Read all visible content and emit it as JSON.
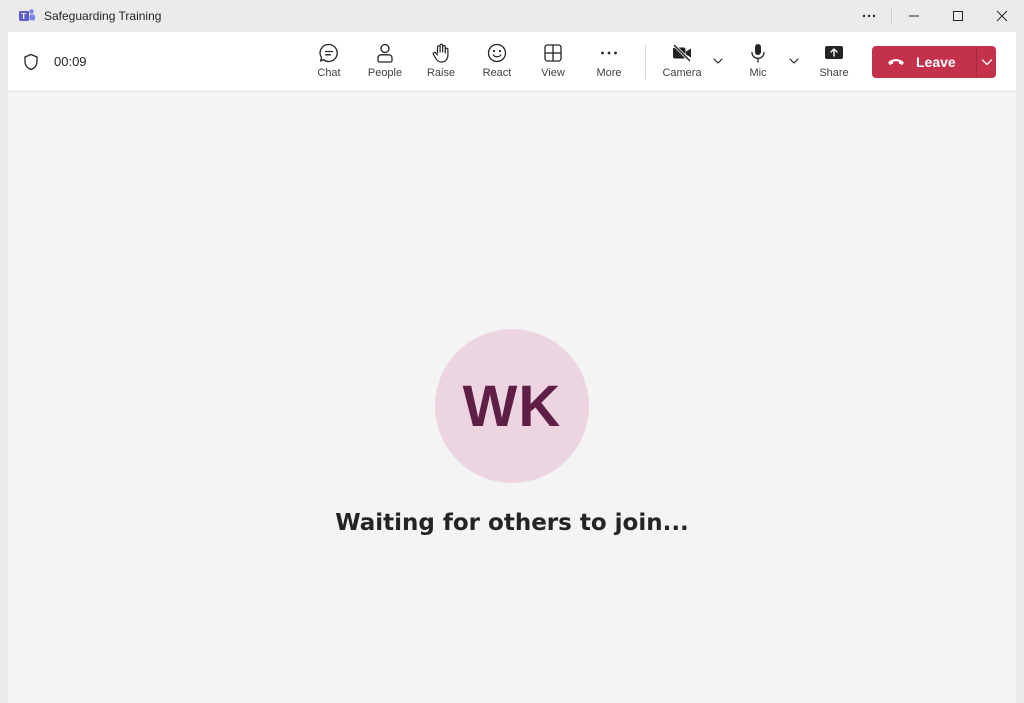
{
  "window": {
    "title": "Safeguarding Training",
    "icons": [
      "teams-logo-icon",
      "more-options-icon",
      "minimize-icon",
      "maximize-icon",
      "close-icon"
    ]
  },
  "meeting": {
    "timer": "00:09",
    "toolbar": {
      "chat_label": "Chat",
      "people_label": "People",
      "raise_label": "Raise",
      "react_label": "React",
      "view_label": "View",
      "more_label": "More",
      "camera_label": "Camera",
      "mic_label": "Mic",
      "share_label": "Share",
      "leave_label": "Leave"
    }
  },
  "stage": {
    "initials": "WK",
    "message": "Waiting for others to join..."
  },
  "colors": {
    "leave_red": "#c4314b",
    "avatar_bg": "#ecd4e1",
    "avatar_text": "#5e1e45",
    "teams_purple": "#5b5fc7"
  }
}
